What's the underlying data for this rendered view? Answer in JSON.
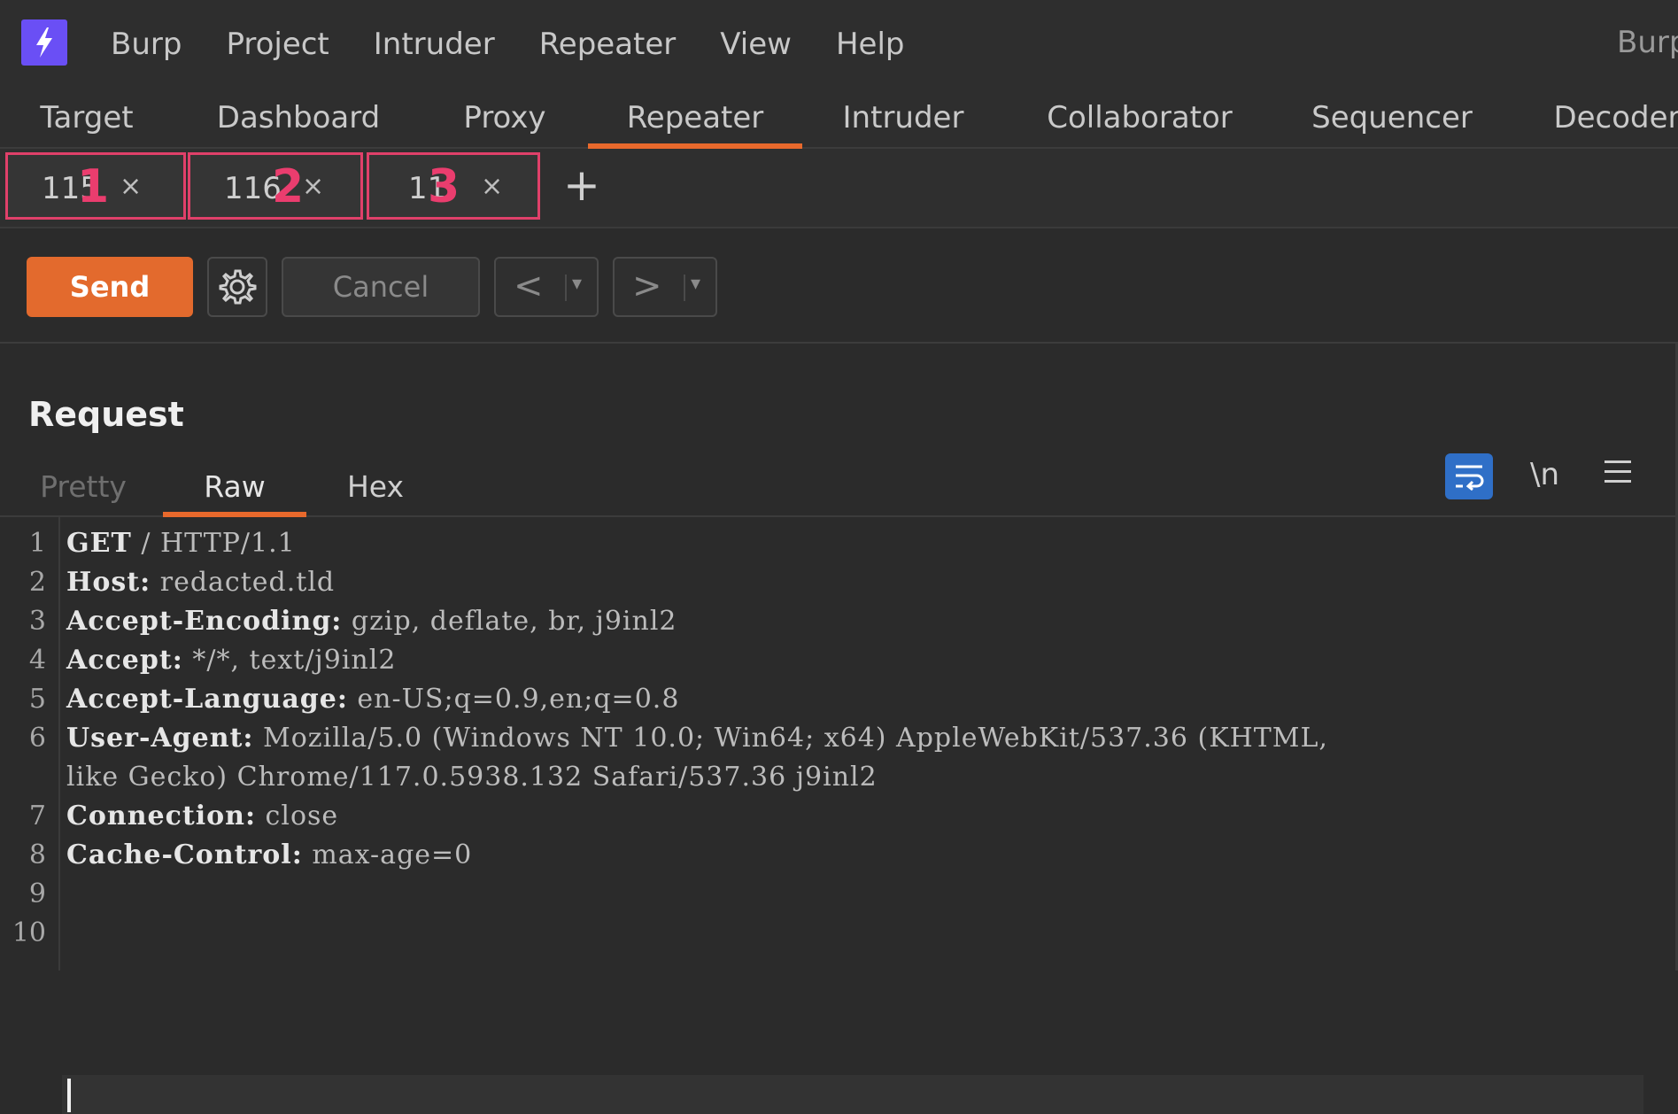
{
  "app": {
    "title": "Burp"
  },
  "menubar": {
    "items": [
      "Burp",
      "Project",
      "Intruder",
      "Repeater",
      "View",
      "Help"
    ]
  },
  "tool_tabs": {
    "items": [
      "Target",
      "Dashboard",
      "Proxy",
      "Repeater",
      "Intruder",
      "Collaborator",
      "Sequencer",
      "Decoder"
    ],
    "active": "Repeater"
  },
  "request_tabs": [
    {
      "label": "115",
      "badge": "1",
      "close": "×"
    },
    {
      "label": "116",
      "badge": "2",
      "close": "×"
    },
    {
      "label": "11",
      "badge": "3",
      "close": "×"
    }
  ],
  "add_tab_label": "+",
  "toolbar": {
    "send_label": "Send",
    "cancel_label": "Cancel",
    "back_label": "<",
    "forward_label": ">",
    "dropdown_glyph": "▾"
  },
  "request_panel": {
    "title": "Request",
    "tabs": [
      "Pretty",
      "Raw",
      "Hex"
    ],
    "active_tab": "Raw",
    "newline_label": "\\n",
    "icons": [
      "wrap-lines-icon",
      "newline-icon",
      "hamburger-menu-icon"
    ]
  },
  "editor": {
    "lines": [
      {
        "num": "1",
        "key": "GET",
        "rest": " / HTTP/1.1"
      },
      {
        "num": "2",
        "key": "Host:",
        "rest": " redacted.tld"
      },
      {
        "num": "3",
        "key": "Accept-Encoding:",
        "rest": " gzip, deflate, br, j9inl2"
      },
      {
        "num": "4",
        "key": "Accept:",
        "rest": " */*, text/j9inl2"
      },
      {
        "num": "5",
        "key": "Accept-Language:",
        "rest": " en-US;q=0.9,en;q=0.8"
      },
      {
        "num": "6",
        "key": "User-Agent:",
        "rest": " Mozilla/5.0 (Windows NT 10.0; Win64; x64) AppleWebKit/537.36 (KHTML,"
      },
      {
        "num": "",
        "key": "",
        "rest": "like Gecko) Chrome/117.0.5938.132 Safari/537.36 j9inl2"
      },
      {
        "num": "7",
        "key": "Connection:",
        "rest": " close"
      },
      {
        "num": "8",
        "key": "Cache-Control:",
        "rest": " max-age=0"
      },
      {
        "num": "9",
        "key": "",
        "rest": ""
      },
      {
        "num": "10",
        "key": "",
        "rest": ""
      }
    ]
  },
  "colors": {
    "accent": "#e8692c",
    "annotation": "#e0406a",
    "logo": "#6a4ff5",
    "wrap_active": "#2f6fc7"
  }
}
